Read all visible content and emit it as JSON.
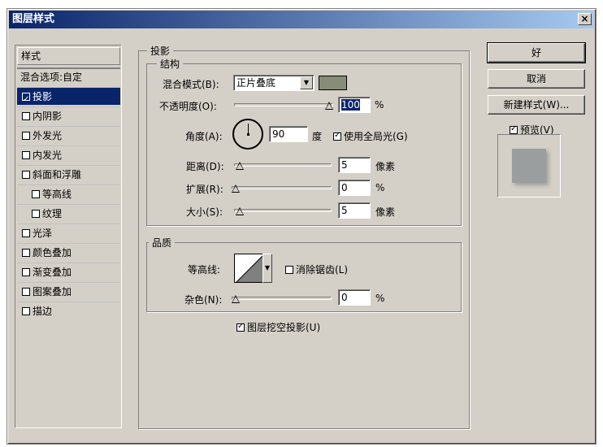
{
  "window": {
    "title": "图层样式",
    "close_glyph": "×"
  },
  "sidebar": {
    "header": "样式",
    "blend_options": "混合选项:自定",
    "items": [
      {
        "label": "投影",
        "checked": true,
        "active": true,
        "sub": false
      },
      {
        "label": "内阴影",
        "checked": false,
        "active": false,
        "sub": false
      },
      {
        "label": "外发光",
        "checked": false,
        "active": false,
        "sub": false
      },
      {
        "label": "内发光",
        "checked": false,
        "active": false,
        "sub": false
      },
      {
        "label": "斜面和浮雕",
        "checked": false,
        "active": false,
        "sub": false
      },
      {
        "label": "等高线",
        "checked": false,
        "active": false,
        "sub": true
      },
      {
        "label": "纹理",
        "checked": false,
        "active": false,
        "sub": true
      },
      {
        "label": "光泽",
        "checked": false,
        "active": false,
        "sub": false
      },
      {
        "label": "颜色叠加",
        "checked": false,
        "active": false,
        "sub": false
      },
      {
        "label": "渐变叠加",
        "checked": false,
        "active": false,
        "sub": false
      },
      {
        "label": "图案叠加",
        "checked": false,
        "active": false,
        "sub": false
      },
      {
        "label": "描边",
        "checked": false,
        "active": false,
        "sub": false
      }
    ]
  },
  "shadow": {
    "section_title": "投影",
    "structure": {
      "title": "结构",
      "blend_mode_label": "混合模式(B):",
      "blend_mode_value": "正片叠底",
      "shadow_color": "#878c78",
      "opacity_label": "不透明度(O):",
      "opacity_value": "100",
      "opacity_level": 1.0,
      "percent": "%",
      "angle_label": "角度(A):",
      "angle_value": "90",
      "angle_unit": "度",
      "global_light_label": "使用全局光(G)",
      "global_light_checked": true,
      "distance_label": "距离(D):",
      "distance_value": "5",
      "distance_unit": "像素",
      "spread_label": "扩展(R):",
      "spread_value": "0",
      "spread_unit": "%",
      "size_label": "大小(S):",
      "size_value": "5",
      "size_unit": "像素"
    },
    "quality": {
      "title": "品质",
      "contour_label": "等高线:",
      "antialias_label": "消除锯齿(L)",
      "antialias_checked": false,
      "noise_label": "杂色(N):",
      "noise_value": "0",
      "noise_unit": "%"
    },
    "knockout_label": "图层挖空投影(U)",
    "knockout_checked": true
  },
  "buttons": {
    "ok": "好",
    "cancel": "取消",
    "new_style": "新建样式(W)...",
    "preview_label": "预览(V)",
    "preview_checked": true
  }
}
